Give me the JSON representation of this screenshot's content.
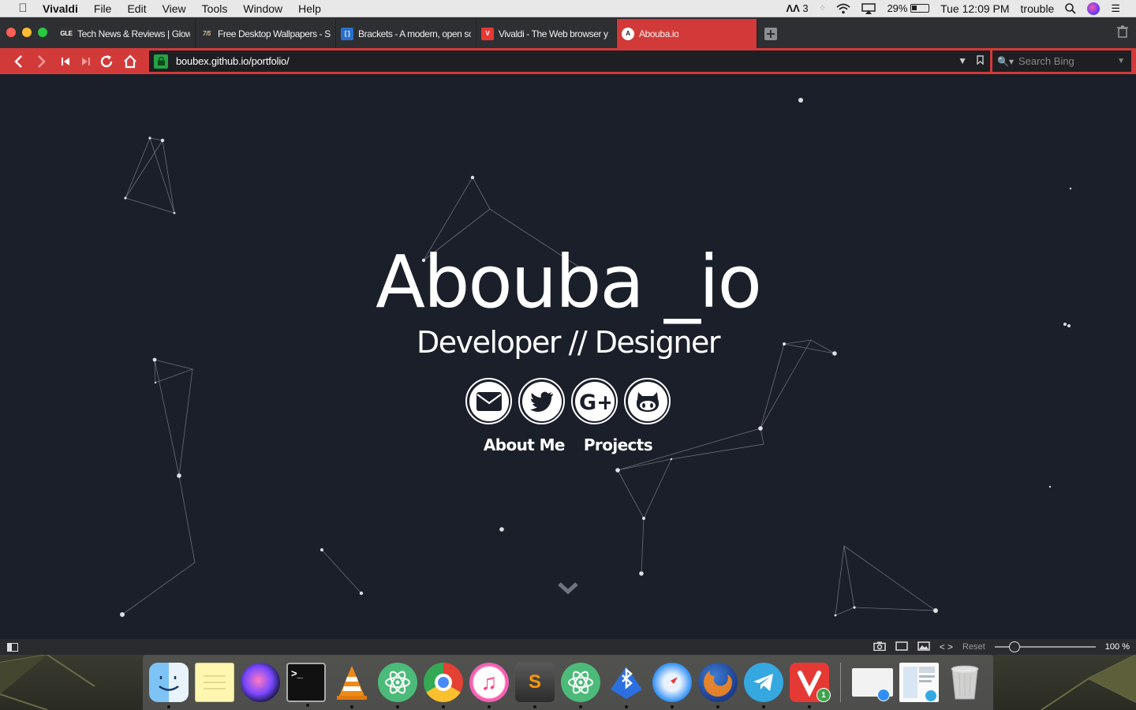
{
  "menubar": {
    "app_name": "Vivaldi",
    "items": [
      "File",
      "Edit",
      "View",
      "Tools",
      "Window",
      "Help"
    ],
    "adobe_count": "3",
    "battery_percent": "29%",
    "clock": "Tue 12:09 PM",
    "user": "trouble"
  },
  "tabs": [
    {
      "title": "Tech News & Reviews | Glow",
      "favicon_text": "GLE",
      "favicon_color": "#333333"
    },
    {
      "title": "Free Desktop Wallpapers - S",
      "favicon_text": "7/5",
      "favicon_color": "#2e2f33"
    },
    {
      "title": "Brackets - A modern, open sc",
      "favicon_text": "[ ]",
      "favicon_color": "#2a6fcd"
    },
    {
      "title": "Vivaldi - The Web browser y",
      "favicon_text": "V",
      "favicon_color": "#e53935"
    },
    {
      "title": "Abouba.io",
      "favicon_text": "A",
      "favicon_color": "#ffffff",
      "active": true
    }
  ],
  "addressbar": {
    "url": "boubex.github.io/portfolio/",
    "search_placeholder": "Search Bing"
  },
  "page": {
    "brand": "Abouba _io",
    "subtitle": "Developer // Designer",
    "social_links": [
      {
        "name": "email",
        "icon": "envelope-icon"
      },
      {
        "name": "twitter",
        "icon": "twitter-icon"
      },
      {
        "name": "google-plus",
        "icon": "google-plus-icon"
      },
      {
        "name": "github",
        "icon": "github-icon"
      }
    ],
    "nav_links": [
      "About Me",
      "Projects"
    ]
  },
  "statusbar": {
    "reset_label": "Reset",
    "zoom_level": "100 %"
  },
  "dock": {
    "apps": [
      "Finder",
      "Notes",
      "Siri",
      "Terminal",
      "VLC",
      "Atom",
      "Chrome",
      "iTunes",
      "Sublime Text",
      "Atom",
      "Bluetooth",
      "Safari",
      "Firefox",
      "Telegram",
      "Vivaldi"
    ],
    "vivaldi_badge": "1"
  }
}
